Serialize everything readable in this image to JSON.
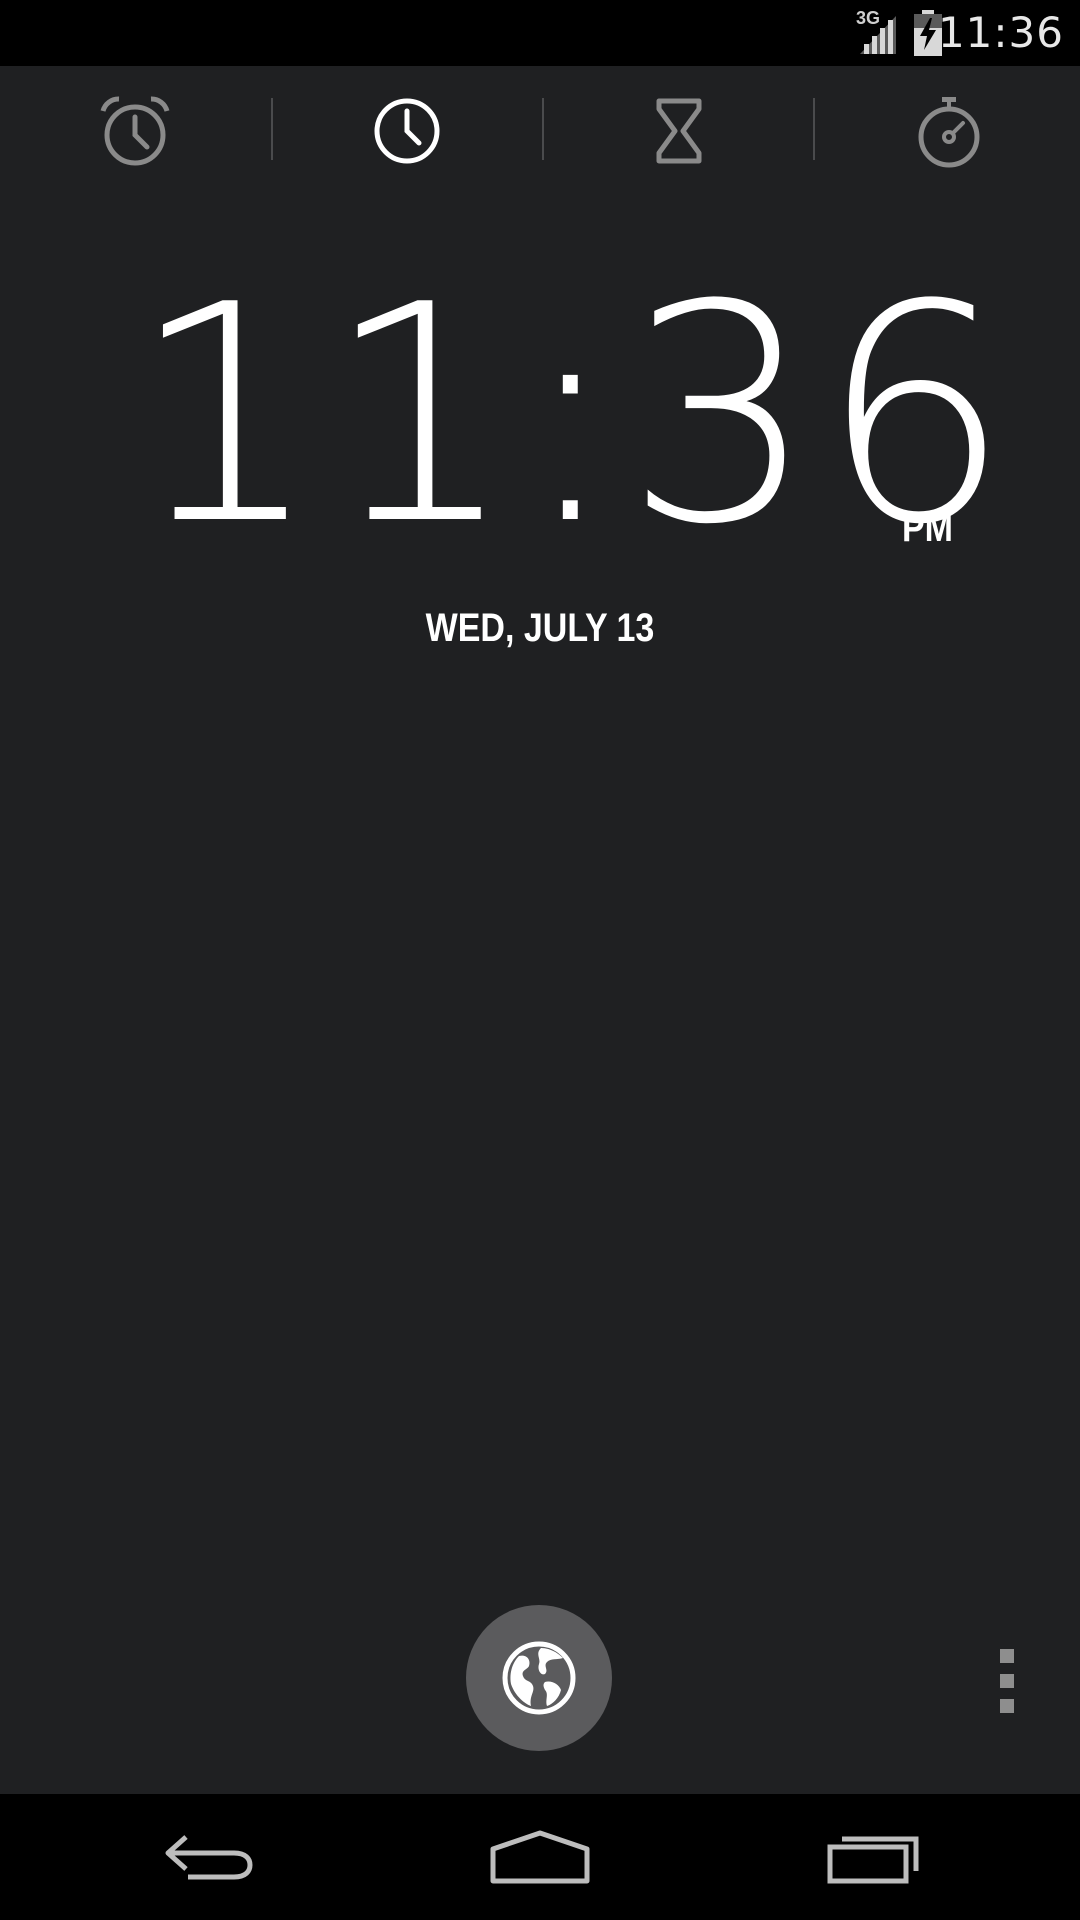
{
  "status_bar": {
    "time": "11:36",
    "network_label": "3G",
    "signal_icon": "signal-icon",
    "battery_icon": "battery-charging-icon"
  },
  "tabs": [
    {
      "name": "alarm",
      "icon": "alarm-clock-icon",
      "selected": false
    },
    {
      "name": "clock",
      "icon": "clock-icon",
      "selected": true
    },
    {
      "name": "timer",
      "icon": "hourglass-icon",
      "selected": false
    },
    {
      "name": "stopwatch",
      "icon": "stopwatch-icon",
      "selected": false
    }
  ],
  "clock": {
    "time": "11:36",
    "ampm": "PM",
    "date": "WED, JULY 13"
  },
  "actions": {
    "fab_icon": "globe-icon",
    "menu_icon": "overflow-menu-icon"
  },
  "nav_bar": {
    "back_icon": "back-icon",
    "home_icon": "home-icon",
    "recents_icon": "recents-icon"
  },
  "colors": {
    "background": "#1f2022",
    "bar": "#000000",
    "text": "#ffffff",
    "icon_inactive": "#8a8a8a",
    "fab": "#5b5b5d"
  }
}
